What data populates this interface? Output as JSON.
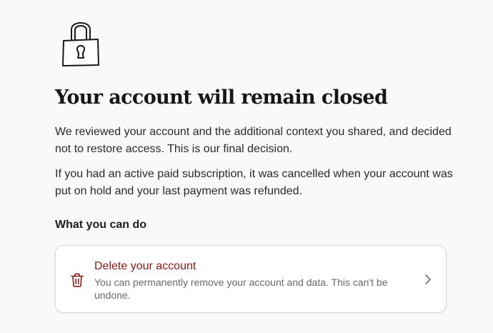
{
  "header": {
    "icon": "lock-icon",
    "title": "Your account will remain closed"
  },
  "body": {
    "paragraph_1": "We reviewed your account and the additional context you shared, and decided not to restore access. This is our final decision.",
    "paragraph_2": "If you had an active paid subscription, it was cancelled when your account was put on hold and your last payment was refunded."
  },
  "actions": {
    "heading": "What you can do",
    "delete_card": {
      "icon": "trash-icon",
      "title": "Delete your account",
      "description": "You can permanently remove your account and data. This can't be undone.",
      "chevron_icon": "chevron-right-icon"
    }
  },
  "colors": {
    "background": "#faf9f7",
    "danger": "#8b1a12",
    "card_border": "#d9d6d0"
  }
}
